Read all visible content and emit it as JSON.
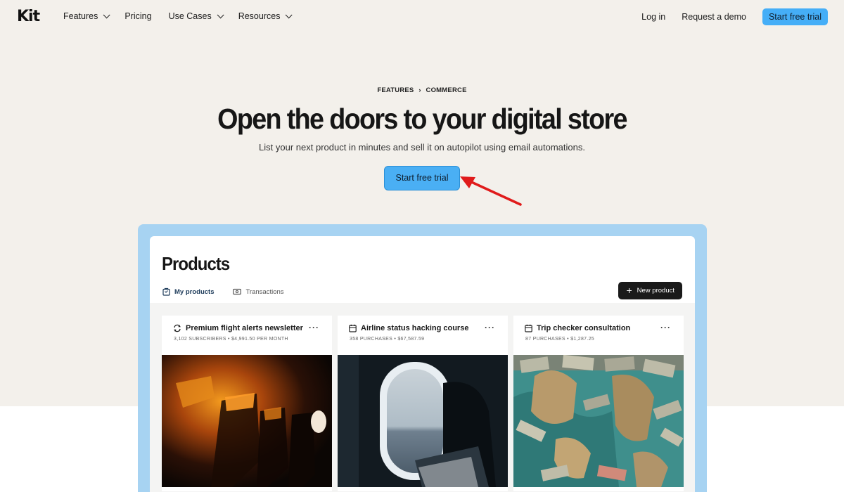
{
  "nav": {
    "logo": "Kit",
    "links": [
      {
        "label": "Features",
        "has_dropdown": true
      },
      {
        "label": "Pricing",
        "has_dropdown": false
      },
      {
        "label": "Use Cases",
        "has_dropdown": true
      },
      {
        "label": "Resources",
        "has_dropdown": true
      }
    ],
    "login": "Log in",
    "demo": "Request a demo",
    "cta": "Start free trial"
  },
  "hero": {
    "breadcrumb_1": "FEATURES",
    "breadcrumb_sep": "›",
    "breadcrumb_2": "COMMERCE",
    "title": "Open the doors to your digital store",
    "subtitle": "List your next product in minutes and sell it on autopilot using email automations.",
    "cta": "Start free trial"
  },
  "products": {
    "title": "Products",
    "tabs": [
      {
        "label": "My products",
        "active": true,
        "icon": "bag-icon"
      },
      {
        "label": "Transactions",
        "active": false,
        "icon": "cash-icon"
      }
    ],
    "new_button": "New product",
    "cards": [
      {
        "title": "Premium flight alerts newsletter",
        "meta": "3,102 SUBSCRIBERS • $4,991.50 PER MONTH",
        "icon": "recurring-icon",
        "image": "airplane-cabin-photo"
      },
      {
        "title": "Airline status hacking course",
        "meta": "358 PURCHASES • $67,587.59",
        "icon": "calendar-icon",
        "image": "airplane-window-photo"
      },
      {
        "title": "Trip checker consultation",
        "meta": "87 PURCHASES • $1,287.25",
        "icon": "calendar-icon",
        "image": "money-map-photo"
      }
    ]
  },
  "colors": {
    "hero_bg": "#f3f0eb",
    "accent_blue": "#45aef7",
    "panel_frame": "#a7d3f2",
    "annotation_arrow": "#e01b1b"
  }
}
